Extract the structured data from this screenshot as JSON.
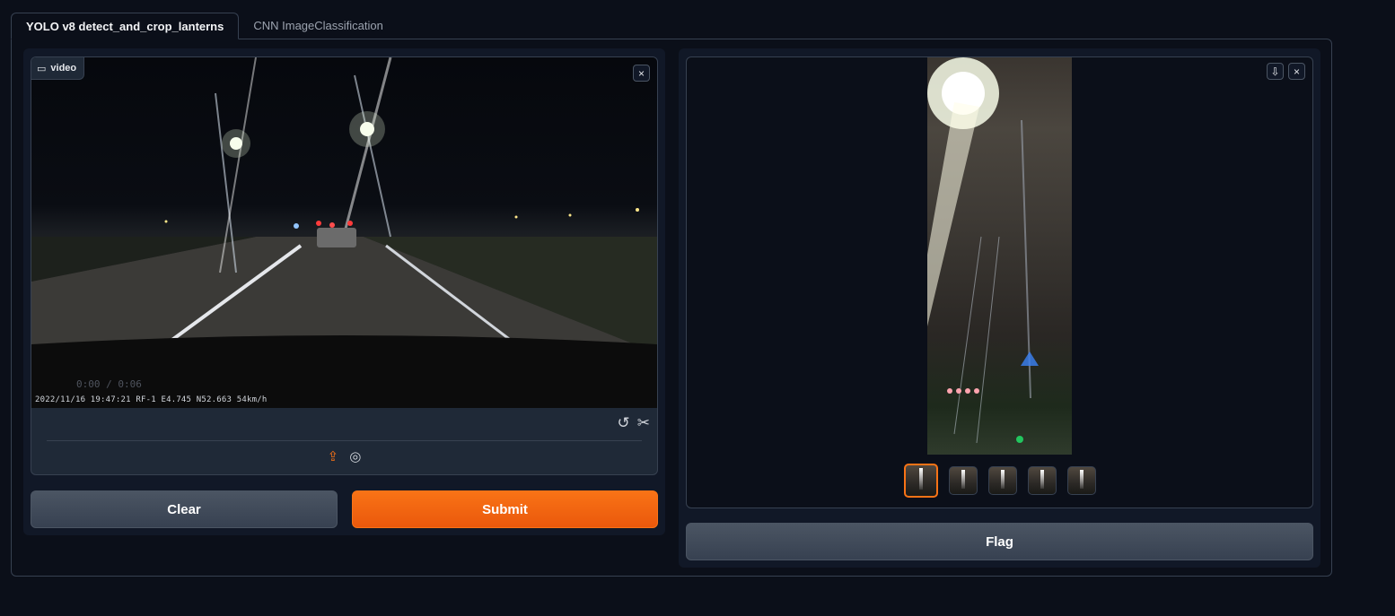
{
  "tabs": [
    {
      "label": "YOLO v8 detect_and_crop_lanterns",
      "active": true
    },
    {
      "label": "CNN ImageClassification",
      "active": false
    }
  ],
  "input": {
    "component_label": "video",
    "playback_time": "0:00 / 0:06",
    "dashcam_stamp": "2022/11/16 19:47:21 RF-1     E4.745 N52.663     54km/h"
  },
  "buttons": {
    "clear": "Clear",
    "submit": "Submit",
    "flag": "Flag"
  },
  "gallery": {
    "thumbnail_count": 5,
    "selected_index": 0
  },
  "colors": {
    "accent": "#f97316",
    "background": "#0b0f19",
    "panel": "#111827",
    "border": "#374151"
  }
}
